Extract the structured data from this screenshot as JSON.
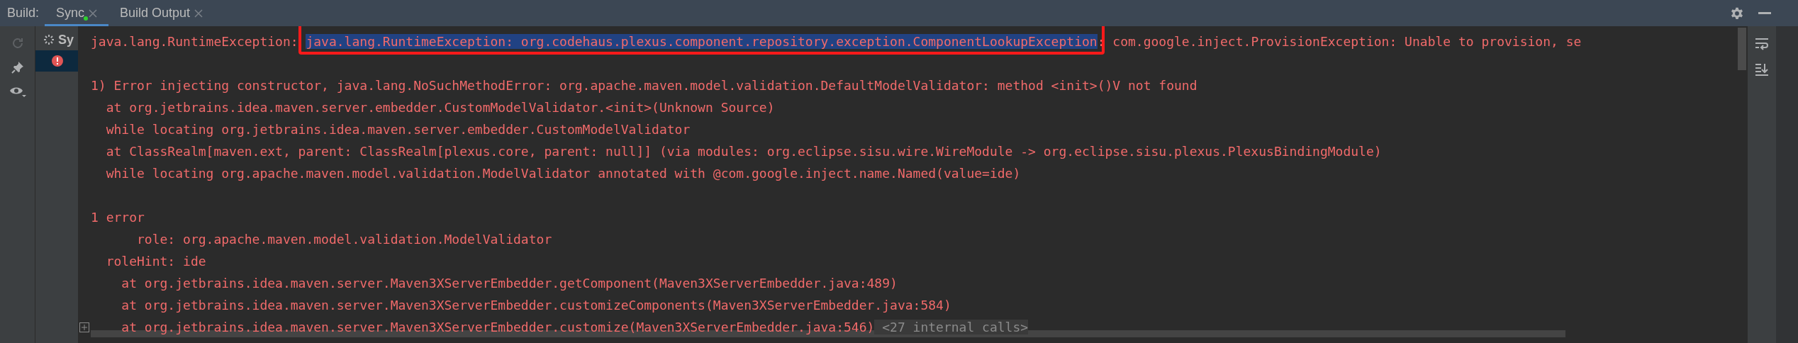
{
  "header": {
    "label": "Build:"
  },
  "tabs": [
    {
      "label": "Sync",
      "selected": true,
      "indicator": true
    },
    {
      "label": "Build Output",
      "selected": false,
      "indicator": false
    }
  ],
  "tree": [
    {
      "kind": "sync",
      "label": "Sy",
      "selected": false
    },
    {
      "kind": "error",
      "selected": true
    }
  ],
  "console": [
    {
      "kind": "text",
      "segments": [
        {
          "kind": "error",
          "text": "java.lang.RuntimeException: "
        },
        {
          "kind": "selected",
          "annotated": true,
          "text": "java.lang.RuntimeException: org.codehaus.plexus.component.repository.exception.ComponentLookupException"
        },
        {
          "kind": "error",
          "text": ": com.google.inject.ProvisionException: Unable to provision, se"
        }
      ]
    },
    {
      "kind": "blank"
    },
    {
      "kind": "text",
      "segments": [
        {
          "kind": "error",
          "text": "1) Error injecting constructor, java.lang.NoSuchMethodError: org.apache.maven.model.validation.DefaultModelValidator: method <init>()V not found"
        }
      ]
    },
    {
      "kind": "text",
      "segments": [
        {
          "kind": "error",
          "text": "  at org.jetbrains.idea.maven.server.embedder.CustomModelValidator.<init>(Unknown Source)"
        }
      ]
    },
    {
      "kind": "text",
      "segments": [
        {
          "kind": "error",
          "text": "  while locating org.jetbrains.idea.maven.server.embedder.CustomModelValidator"
        }
      ]
    },
    {
      "kind": "text",
      "segments": [
        {
          "kind": "error",
          "text": "  at ClassRealm[maven.ext, parent: ClassRealm[plexus.core, parent: null]] (via modules: org.eclipse.sisu.wire.WireModule -> org.eclipse.sisu.plexus.PlexusBindingModule)"
        }
      ]
    },
    {
      "kind": "text",
      "segments": [
        {
          "kind": "error",
          "text": "  while locating org.apache.maven.model.validation.ModelValidator annotated with @com.google.inject.name.Named(value=ide)"
        }
      ]
    },
    {
      "kind": "blank"
    },
    {
      "kind": "text",
      "segments": [
        {
          "kind": "error",
          "text": "1 error"
        }
      ]
    },
    {
      "kind": "text",
      "segments": [
        {
          "kind": "error",
          "text": "      role: org.apache.maven.model.validation.ModelValidator"
        }
      ]
    },
    {
      "kind": "text",
      "segments": [
        {
          "kind": "error",
          "text": "  roleHint: ide"
        }
      ]
    },
    {
      "kind": "text",
      "segments": [
        {
          "kind": "error",
          "text": "    at org.jetbrains.idea.maven.server.Maven3XServerEmbedder.getComponent(Maven3XServerEmbedder.java:489)"
        }
      ]
    },
    {
      "kind": "text",
      "segments": [
        {
          "kind": "error",
          "text": "    at org.jetbrains.idea.maven.server.Maven3XServerEmbedder.customizeComponents(Maven3XServerEmbedder.java:584)"
        }
      ]
    },
    {
      "kind": "text",
      "folded": true,
      "segments": [
        {
          "kind": "error",
          "text": "    at org.jetbrains.idea.maven.server.Maven3XServerEmbedder.customize(Maven3XServerEmbedder.java:546)"
        },
        {
          "kind": "hint",
          "text": " <27 internal calls>"
        }
      ]
    }
  ]
}
